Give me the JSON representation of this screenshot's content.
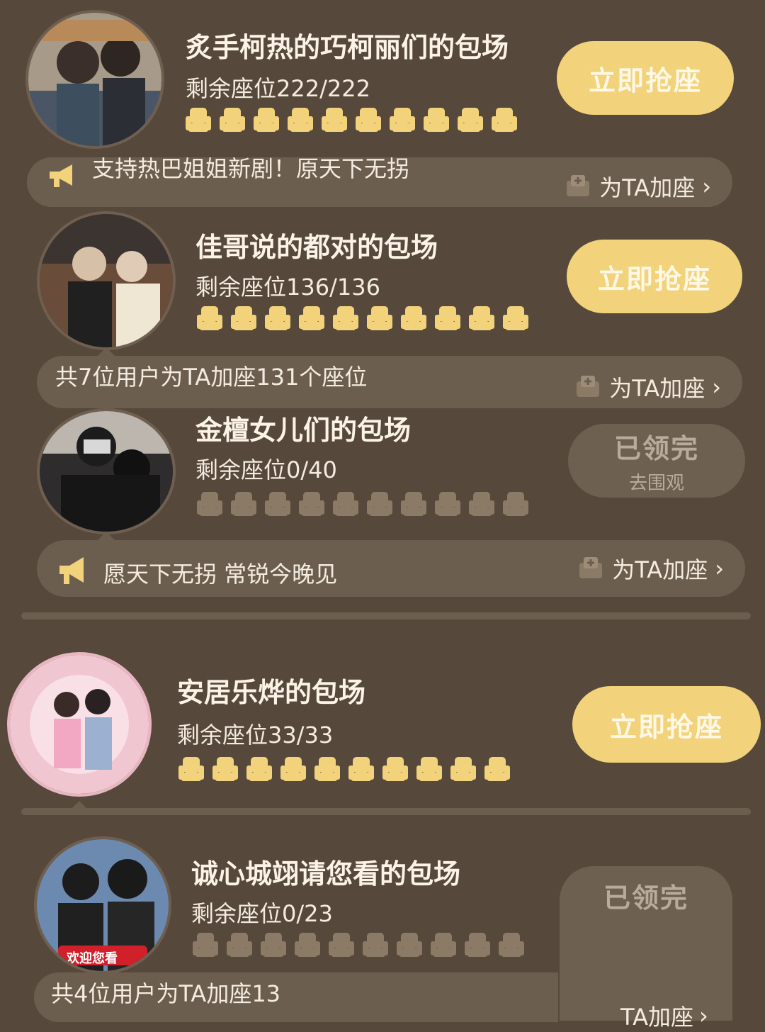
{
  "colors": {
    "background": "#56483b",
    "seat_active": "#f2d27a",
    "seat_inactive": "#8a7a66",
    "button": "#f2d27a",
    "button_done": "#6e6051",
    "strip": "#6b5e4f"
  },
  "cards": [
    {
      "title": "炙手柯热的巧柯丽们的包场",
      "remaining": "剩余座位222/222",
      "seats_filled": 10,
      "button": "立即抢座",
      "strip_message": "支持热巴姐姐新剧！原天下无拐",
      "strip_icon": "megaphone-icon",
      "add_label": "为TA加座"
    },
    {
      "title": "佳哥说的都对的包场",
      "remaining": "剩余座位136/136",
      "seats_filled": 10,
      "button": "立即抢座",
      "strip_message": "共7位用户为TA加座131个座位",
      "add_label": "为TA加座"
    },
    {
      "title": "金檀女儿们的包场",
      "remaining": "剩余座位0/40",
      "seats_filled": 0,
      "button_done": "已领完",
      "button_done_sub": "去围观",
      "strip_message": "愿天下无拐 常锐今晚见",
      "strip_icon": "megaphone-icon",
      "add_label": "为TA加座"
    },
    {
      "title": "安居乐烨的包场",
      "remaining": "剩余座位33/33",
      "seats_filled": 10,
      "button": "立即抢座"
    },
    {
      "title": "诚心城翊请您看的包场",
      "remaining": "剩余座位0/23",
      "seats_filled": 0,
      "button_done": "已领完",
      "strip_message": "共4位用户为TA加座13",
      "add_label": "TA加座",
      "avatar_banner": "欢迎您看"
    }
  ]
}
